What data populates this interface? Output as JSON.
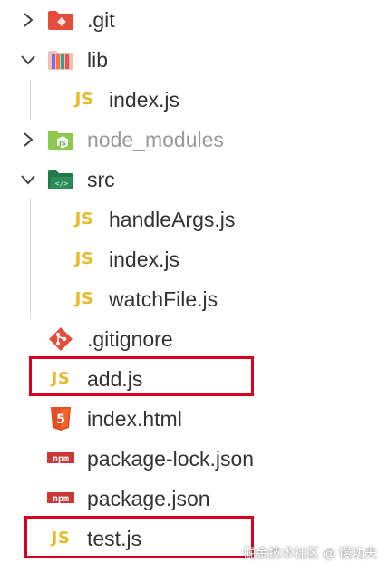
{
  "explorer": {
    "rows": [
      {
        "label": ".git",
        "kind": "folder",
        "expanded": false,
        "icon": "git-folder-icon"
      },
      {
        "label": "lib",
        "kind": "folder",
        "expanded": true,
        "icon": "lib-folder-icon"
      },
      {
        "label": "index.js",
        "kind": "file",
        "icon": "js-file-icon"
      },
      {
        "label": "node_modules",
        "kind": "folder",
        "expanded": false,
        "icon": "node-folder-icon",
        "dimmed": true
      },
      {
        "label": "src",
        "kind": "folder",
        "expanded": true,
        "icon": "src-folder-icon"
      },
      {
        "label": "handleArgs.js",
        "kind": "file",
        "icon": "js-file-icon"
      },
      {
        "label": "index.js",
        "kind": "file",
        "icon": "js-file-icon"
      },
      {
        "label": "watchFile.js",
        "kind": "file",
        "icon": "js-file-icon"
      },
      {
        "label": ".gitignore",
        "kind": "file",
        "icon": "git-diamond-icon"
      },
      {
        "label": "add.js",
        "kind": "file",
        "icon": "js-file-icon",
        "highlighted": true
      },
      {
        "label": "index.html",
        "kind": "file",
        "icon": "html5-icon"
      },
      {
        "label": "package-lock.json",
        "kind": "file",
        "icon": "npm-icon"
      },
      {
        "label": "package.json",
        "kind": "file",
        "icon": "npm-icon"
      },
      {
        "label": "test.js",
        "kind": "file",
        "icon": "js-file-icon",
        "highlighted": true
      }
    ],
    "js_badge": "JS",
    "html_badge": "5",
    "npm_badge": "npm"
  },
  "colors": {
    "highlight_border": "#d9001b",
    "js_yellow": "#e7bb2a",
    "git_red": "#e44d3a",
    "html_orange": "#e44d26",
    "npm_red": "#cb3837",
    "node_green": "#8cc84b",
    "src_green": "#2e8b57",
    "text": "#333333",
    "dim_text": "#999999"
  },
  "watermark": "掘金技术社区 @ 慢功夫"
}
